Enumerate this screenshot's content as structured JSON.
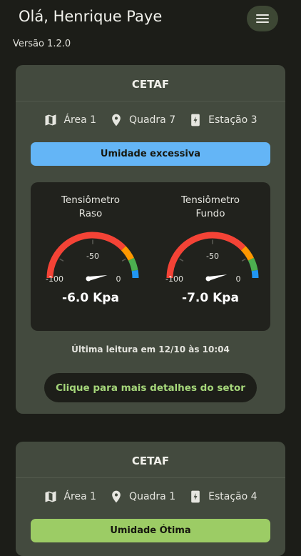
{
  "header": {
    "greeting": "Olá, Henrique Paye",
    "version": "Versão 1.2.0",
    "menu_icon": "hamburger-menu-icon"
  },
  "sectors": [
    {
      "title": "CETAF",
      "area": "Área 1",
      "quadra": "Quadra 7",
      "estacao": "Estação 3",
      "status": "Umidade excessiva",
      "status_color": "#64b5f6",
      "gauges": [
        {
          "label_line1": "Tensiômetro",
          "label_line2": "Raso",
          "value": -6.0,
          "value_text": "-6.0 Kpa",
          "min_label": "-100",
          "mid_label": "-50",
          "max_label": "0"
        },
        {
          "label_line1": "Tensiômetro",
          "label_line2": "Fundo",
          "value": -7.0,
          "value_text": "-7.0 Kpa",
          "min_label": "-100",
          "mid_label": "-50",
          "max_label": "0"
        }
      ],
      "last_reading": "Última leitura em 12/10 às 10:04",
      "details_button": "Clique para mais detalhes do setor"
    },
    {
      "title": "CETAF",
      "area": "Área 1",
      "quadra": "Quadra 1",
      "estacao": "Estação 4",
      "status": "Umidade Ótima",
      "status_color": "#9ccc65"
    }
  ],
  "colors": {
    "background": "#1c1d18",
    "card": "#434a3e",
    "gauge_panel": "#21221d",
    "accent_green": "#a5d67a",
    "gauge_red": "#f44336",
    "gauge_orange": "#ff9800",
    "gauge_green": "#4caf50",
    "gauge_blue": "#2196f3"
  },
  "icons": [
    "map-icon",
    "location-pin-icon",
    "station-device-icon",
    "hamburger-menu-icon"
  ]
}
